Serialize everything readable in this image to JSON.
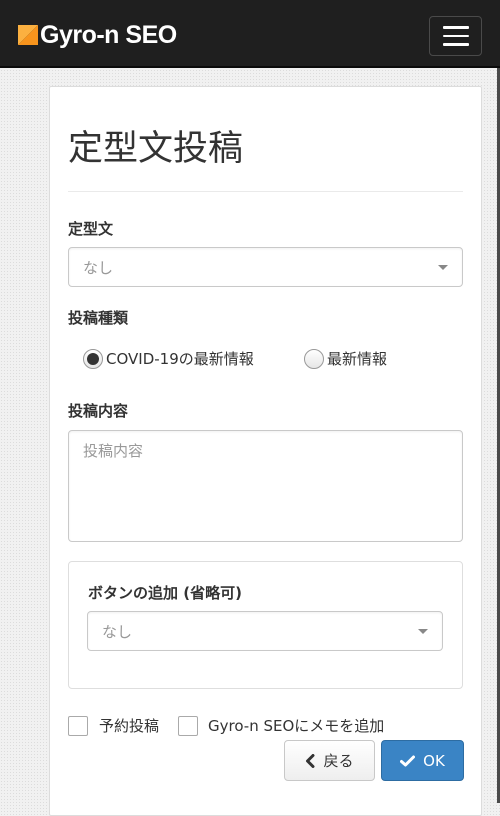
{
  "app": {
    "brand": "Gyro-n SEO",
    "brand_icon": "gyron-logo-icon",
    "menu_icon": "hamburger-menu-icon",
    "accent_color": "#f7941d"
  },
  "form": {
    "title": "定型文投稿",
    "template": {
      "label": "定型文",
      "value": "なし"
    },
    "post_type": {
      "label": "投稿種類",
      "options": [
        {
          "label": "COVID-19の最新情報",
          "checked": true
        },
        {
          "label": "最新情報",
          "checked": false
        }
      ]
    },
    "content": {
      "label": "投稿内容",
      "placeholder": "投稿内容"
    },
    "button_add": {
      "label": "ボタンの追加 (省略可)",
      "value": "なし"
    },
    "options": [
      {
        "label": "予約投稿",
        "checked": false
      },
      {
        "label": "Gyro-n SEOにメモを追加",
        "checked": false
      }
    ],
    "actions": {
      "back_label": "戻る",
      "back_icon": "chevron-left-icon",
      "ok_label": "OK",
      "ok_icon": "checkmark-icon",
      "ok_color": "#3a84c5"
    }
  }
}
